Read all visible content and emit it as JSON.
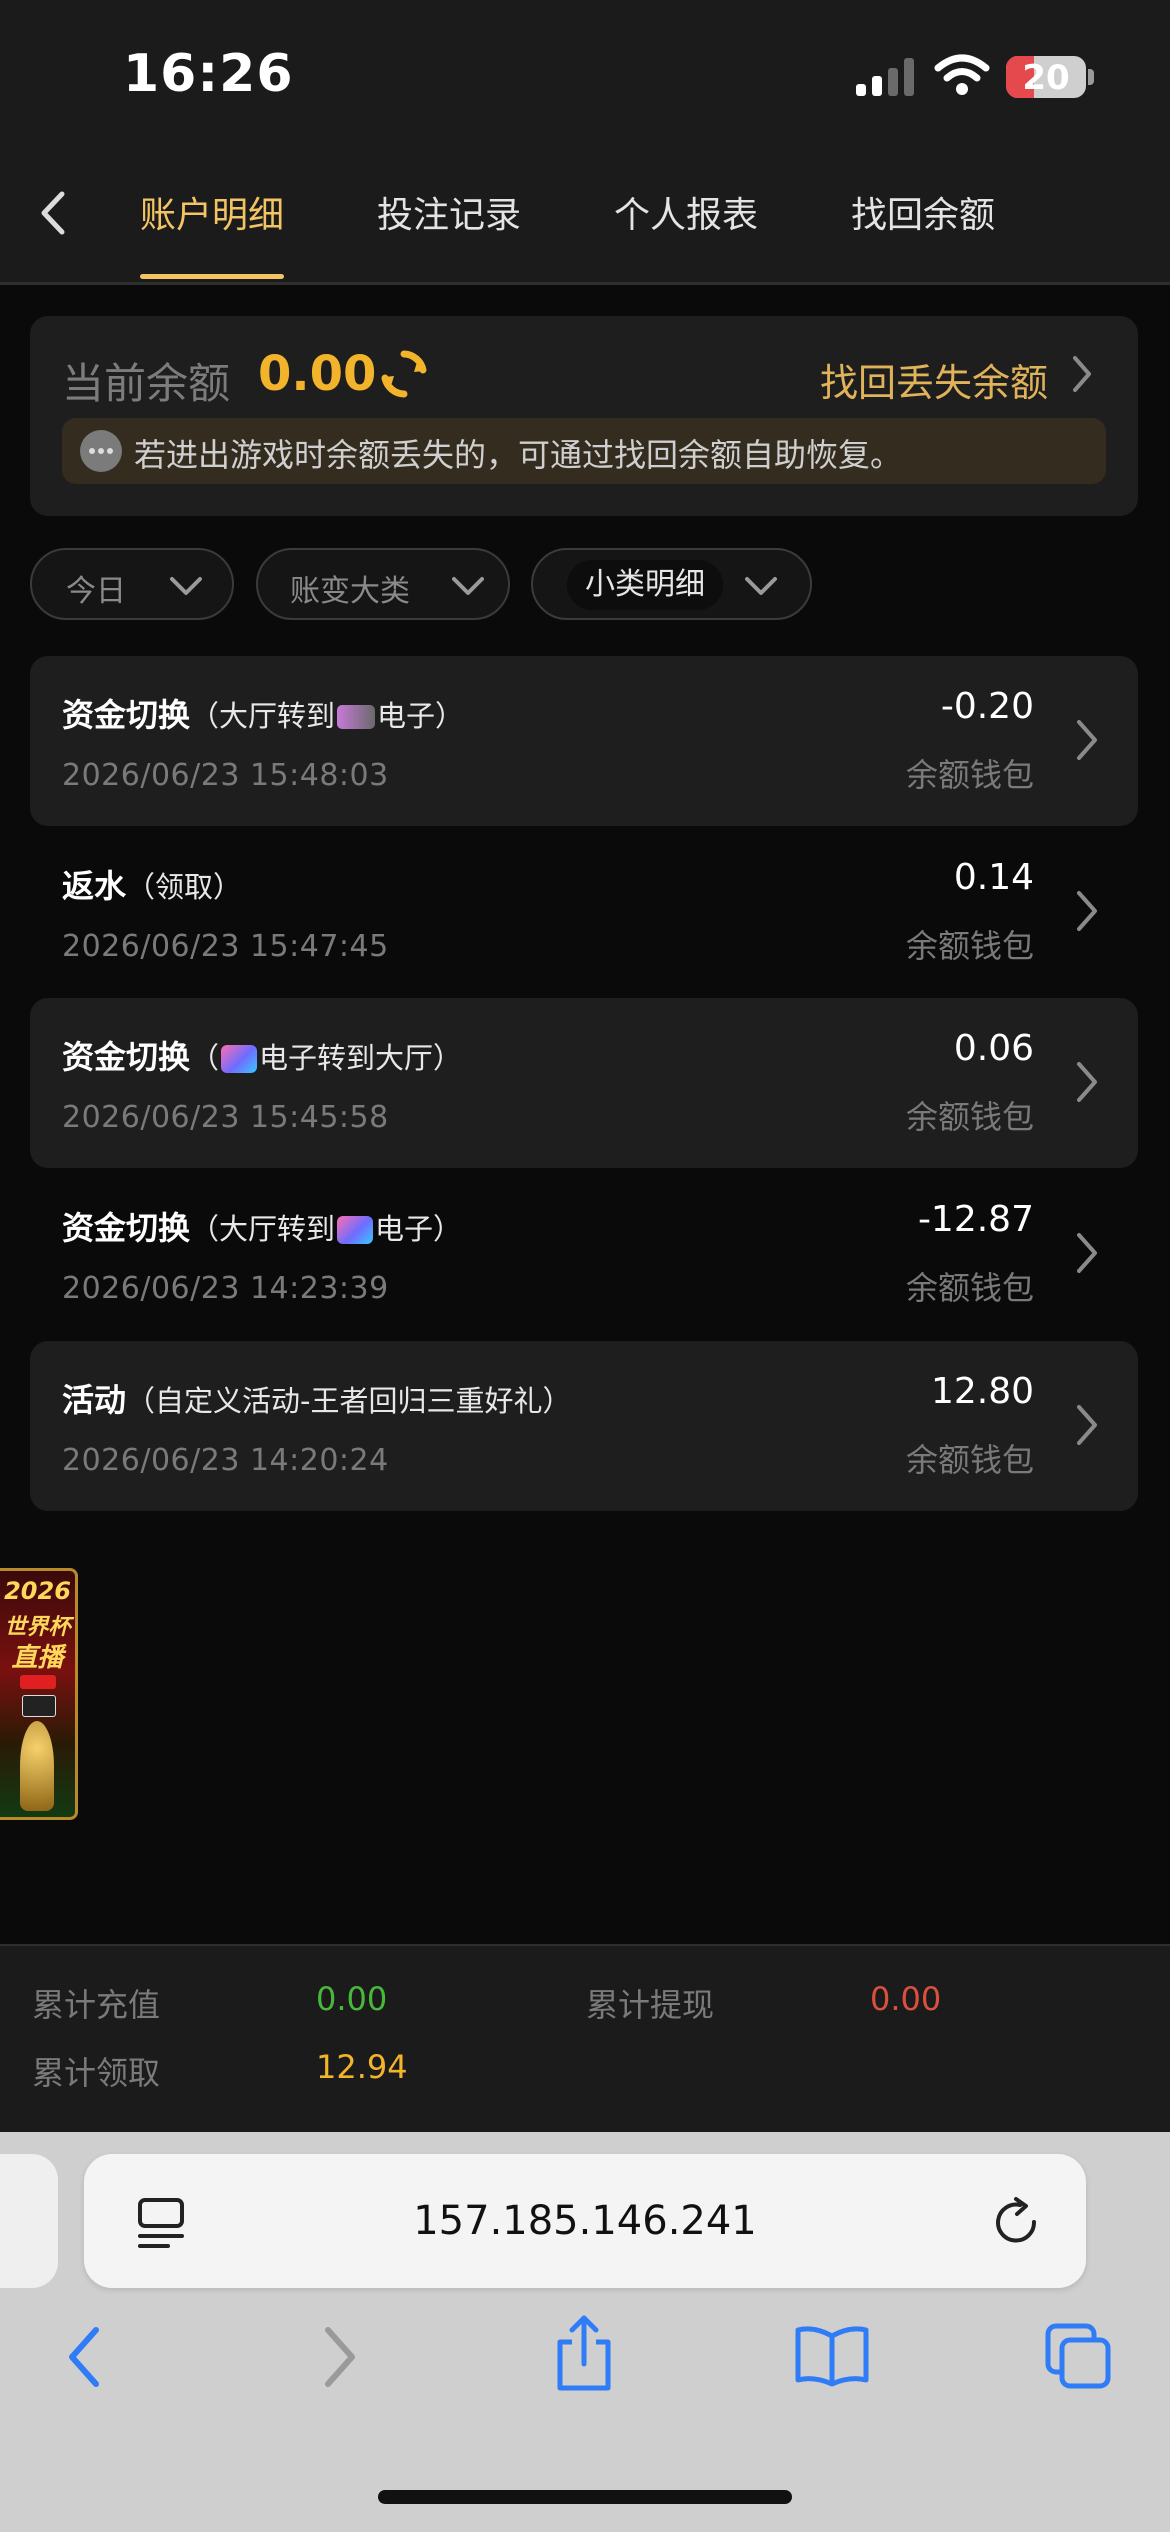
{
  "status_bar": {
    "time": "16:26",
    "battery": "20"
  },
  "nav": {
    "tabs": [
      {
        "label": "账户明细",
        "active": true
      },
      {
        "label": "投注记录",
        "active": false
      },
      {
        "label": "个人报表",
        "active": false
      },
      {
        "label": "找回余额",
        "active": false
      }
    ]
  },
  "balance": {
    "label": "当前余额",
    "value": "0.00",
    "recover_link": "找回丢失余额",
    "notice": "若进出游戏时余额丢失的，可通过找回余额自助恢复。"
  },
  "filters": [
    {
      "label": "今日"
    },
    {
      "label": "账变大类"
    },
    {
      "label": "小类明细"
    }
  ],
  "transactions": [
    {
      "type": "资金切换",
      "paren_open": "（大厅转到",
      "logo": "pg-logo",
      "paren_close": "电子）",
      "amount": "-0.20",
      "wallet": "余额钱包",
      "datetime": "2026/06/23 15:48:03"
    },
    {
      "type": "返水",
      "detail": "（领取）",
      "amount": "0.14",
      "wallet": "余额钱包",
      "datetime": "2026/06/23 15:47:45"
    },
    {
      "type": "资金切换",
      "paren_open": "（",
      "logo": "lg-logo",
      "paren_close": "电子转到大厅）",
      "amount": "0.06",
      "wallet": "余额钱包",
      "datetime": "2026/06/23 15:45:58"
    },
    {
      "type": "资金切换",
      "paren_open": "（大厅转到",
      "logo": "lg-logo",
      "paren_close": "电子）",
      "amount": "-12.87",
      "wallet": "余额钱包",
      "datetime": "2026/06/23 14:23:39"
    },
    {
      "type": "活动",
      "detail": "（自定义活动-王者回归三重好礼）",
      "amount": "12.80",
      "wallet": "余额钱包",
      "datetime": "2026/06/23 14:20:24"
    }
  ],
  "promo_banner": {
    "year": "2026",
    "line1": "世界杯",
    "line2": "直播"
  },
  "summary": {
    "deposit_label": "累计充值",
    "deposit_value": "0.00",
    "withdraw_label": "累计提现",
    "withdraw_value": "0.00",
    "claim_label": "累计领取",
    "claim_value": "12.94"
  },
  "colors": {
    "accent": "#f2c463",
    "balance": "#f2b42b",
    "deposit": "#48b83a",
    "withdraw": "#d9503f",
    "claim": "#f2b42b",
    "safari_blue": "#2f7cf6"
  },
  "browser": {
    "url": "157.185.146.241"
  }
}
